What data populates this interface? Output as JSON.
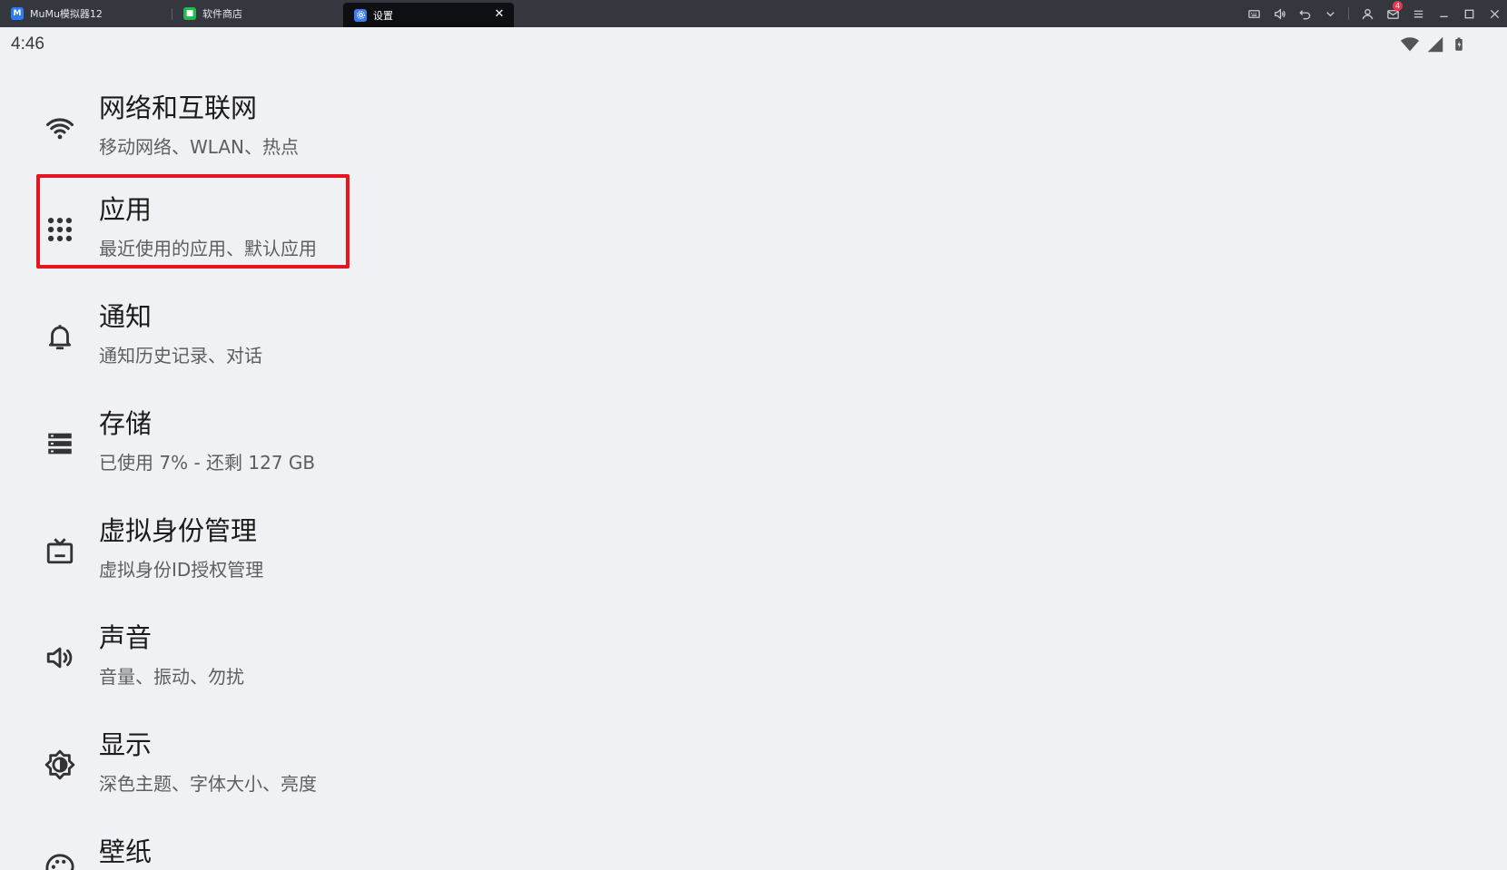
{
  "titlebar": {
    "tabs": [
      {
        "label": "MuMu模拟器12",
        "icon": "mumu-logo-icon",
        "active": false
      },
      {
        "label": "软件商店",
        "icon": "app-store-icon",
        "active": false
      },
      {
        "label": "设置",
        "icon": "settings-gear-icon",
        "active": true
      }
    ],
    "close_glyph": "✕",
    "mail_badge": "4"
  },
  "statusbar": {
    "time": "4:46"
  },
  "settings": {
    "items": [
      {
        "title": "网络和互联网",
        "subtitle": "移动网络、WLAN、热点",
        "icon": "wifi-icon"
      },
      {
        "title": "应用",
        "subtitle": "最近使用的应用、默认应用",
        "icon": "apps-grid-icon"
      },
      {
        "title": "通知",
        "subtitle": "通知历史记录、对话",
        "icon": "bell-icon"
      },
      {
        "title": "存储",
        "subtitle": "已使用 7% - 还剩 127 GB",
        "icon": "storage-icon"
      },
      {
        "title": "虚拟身份管理",
        "subtitle": "虚拟身份ID授权管理",
        "icon": "tv-identity-icon"
      },
      {
        "title": "声音",
        "subtitle": "音量、振动、勿扰",
        "icon": "volume-icon"
      },
      {
        "title": "显示",
        "subtitle": "深色主题、字体大小、亮度",
        "icon": "brightness-icon"
      },
      {
        "title": "壁纸",
        "subtitle": "",
        "icon": "palette-icon"
      }
    ]
  },
  "colors": {
    "titlebar_bg": "#34373e",
    "active_tab_bg": "#0e0f12",
    "page_bg": "#f0f1f4",
    "highlight": "#e8141f",
    "badge": "#e8364f"
  }
}
